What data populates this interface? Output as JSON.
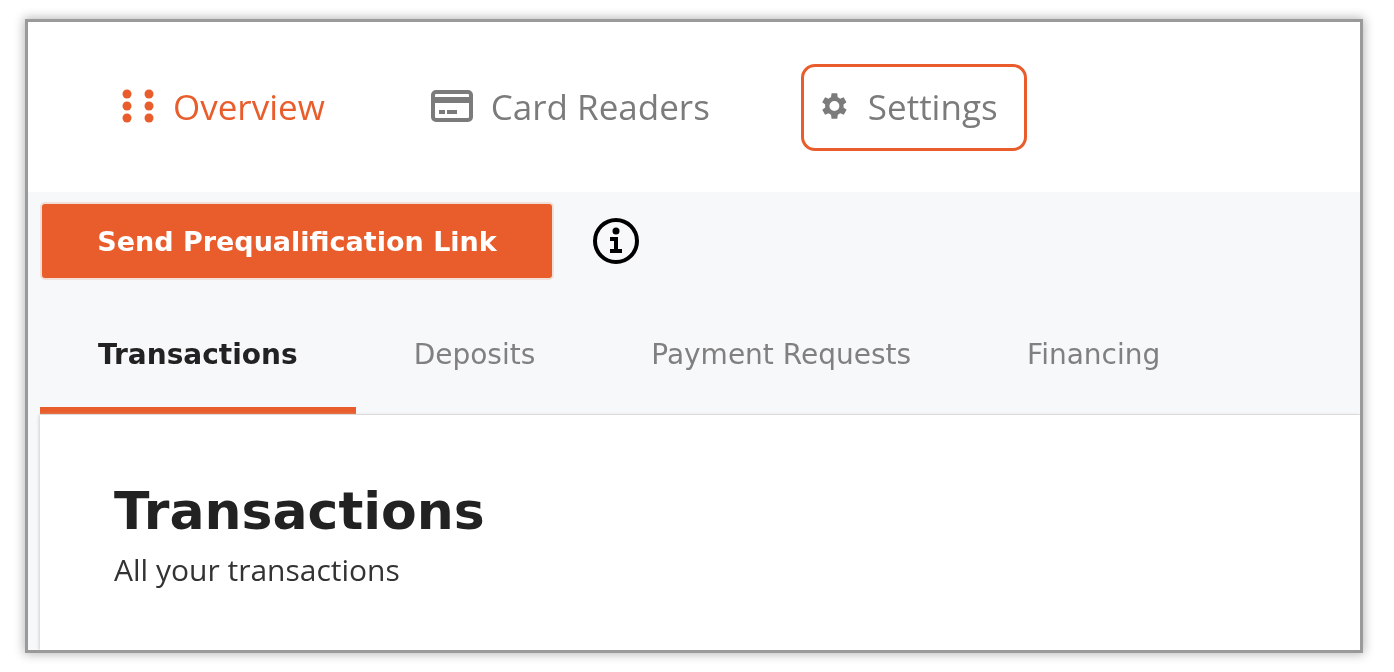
{
  "nav": [
    {
      "label": "Overview",
      "selected": true,
      "highlighted": false
    },
    {
      "label": "Card Readers",
      "selected": false,
      "highlighted": false
    },
    {
      "label": "Settings",
      "selected": false,
      "highlighted": true
    }
  ],
  "action_button": {
    "label": "Send Prequalification Link"
  },
  "tabs": [
    {
      "label": "Transactions",
      "selected": true
    },
    {
      "label": "Deposits",
      "selected": false
    },
    {
      "label": "Payment Requests",
      "selected": false
    },
    {
      "label": "Financing",
      "selected": false
    }
  ],
  "panel": {
    "title": "Transactions",
    "subtitle": "All your transactions"
  }
}
